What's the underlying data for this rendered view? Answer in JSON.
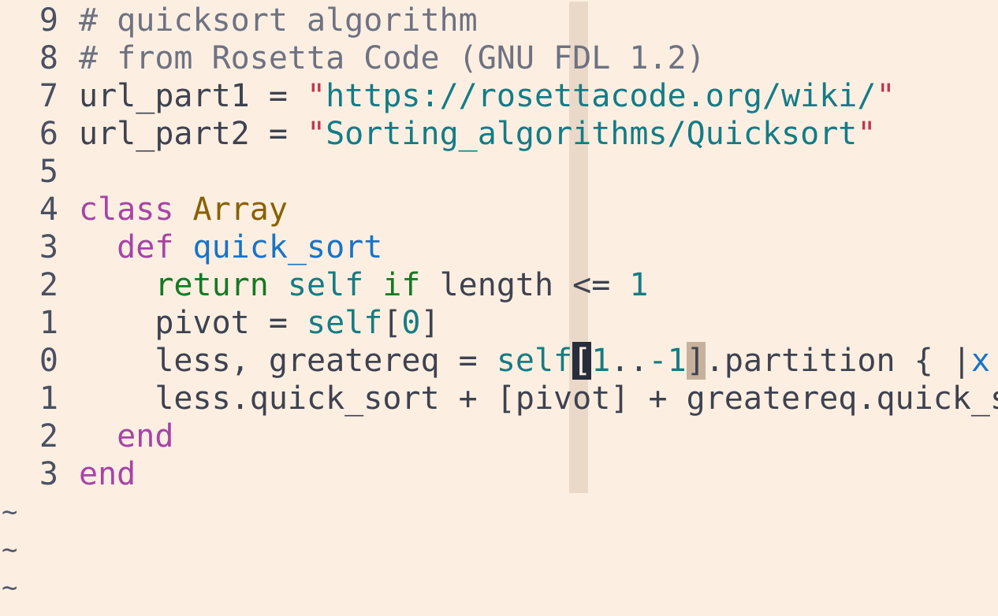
{
  "editor": {
    "lines": [
      {
        "number": "9",
        "segments": [
          {
            "text": "# quicksort algorithm",
            "kind": "comment"
          }
        ]
      },
      {
        "number": "8",
        "segments": [
          {
            "text": "# from Rosetta Code (GNU FDL 1.2)",
            "kind": "comment"
          }
        ]
      },
      {
        "number": "7",
        "segments": [
          {
            "text": "url_part1 = ",
            "kind": "default"
          },
          {
            "text": "\"",
            "kind": "quote"
          },
          {
            "text": "https://rosettacode.org/wiki/",
            "kind": "string"
          },
          {
            "text": "\"",
            "kind": "quote"
          }
        ]
      },
      {
        "number": "6",
        "segments": [
          {
            "text": "url_part2 = ",
            "kind": "default"
          },
          {
            "text": "\"",
            "kind": "quote"
          },
          {
            "text": "Sorting_algorithms/Quicksort",
            "kind": "string"
          },
          {
            "text": "\"",
            "kind": "quote"
          }
        ]
      },
      {
        "number": "5",
        "segments": []
      },
      {
        "number": "4",
        "segments": [
          {
            "text": "class",
            "kind": "keyword-purple"
          },
          {
            "text": " ",
            "kind": "default"
          },
          {
            "text": "Array",
            "kind": "type"
          }
        ]
      },
      {
        "number": "3",
        "segments": [
          {
            "text": "  ",
            "kind": "default"
          },
          {
            "text": "def",
            "kind": "keyword-purple"
          },
          {
            "text": " ",
            "kind": "default"
          },
          {
            "text": "quick_sort",
            "kind": "function"
          }
        ]
      },
      {
        "number": "2",
        "segments": [
          {
            "text": "    ",
            "kind": "default"
          },
          {
            "text": "return",
            "kind": "keyword-green"
          },
          {
            "text": " ",
            "kind": "default"
          },
          {
            "text": "self",
            "kind": "keyword-teal"
          },
          {
            "text": " ",
            "kind": "default"
          },
          {
            "text": "if",
            "kind": "keyword-green"
          },
          {
            "text": " length <= ",
            "kind": "default"
          },
          {
            "text": "1",
            "kind": "number"
          }
        ]
      },
      {
        "number": "1",
        "segments": [
          {
            "text": "    pivot = ",
            "kind": "default"
          },
          {
            "text": "self",
            "kind": "keyword-teal"
          },
          {
            "text": "[",
            "kind": "default"
          },
          {
            "text": "0",
            "kind": "number"
          },
          {
            "text": "]",
            "kind": "default"
          }
        ]
      },
      {
        "number": "0",
        "segments": [
          {
            "text": "    less, greatereq = ",
            "kind": "default"
          },
          {
            "text": "self",
            "kind": "keyword-teal"
          },
          {
            "text": "[",
            "kind": "cursor"
          },
          {
            "text": "1",
            "kind": "number"
          },
          {
            "text": "..",
            "kind": "default"
          },
          {
            "text": "-1",
            "kind": "number"
          },
          {
            "text": "]",
            "kind": "matched-bracket"
          },
          {
            "text": ".partition { |",
            "kind": "default"
          },
          {
            "text": "x",
            "kind": "function"
          },
          {
            "text": "|",
            "kind": "default"
          }
        ]
      },
      {
        "number": "1",
        "segments": [
          {
            "text": "    less.quick_sort + [pivot] + greatereq.quick_s",
            "kind": "default"
          }
        ]
      },
      {
        "number": "2",
        "segments": [
          {
            "text": "  ",
            "kind": "default"
          },
          {
            "text": "end",
            "kind": "keyword-purple"
          }
        ]
      },
      {
        "number": "3",
        "segments": [
          {
            "text": "end",
            "kind": "keyword-purple"
          }
        ]
      }
    ],
    "empty_line_markers": [
      "~",
      "~",
      "~"
    ],
    "colors": {
      "background": "#fcefe2",
      "cursor_column": "#ead9c8",
      "comment": "#6e7282",
      "string": "#137c86",
      "quote": "#c2364d",
      "keyword_purple": "#a644a7",
      "type": "#896100",
      "function": "#1874c8",
      "keyword_green": "#147a22"
    }
  }
}
